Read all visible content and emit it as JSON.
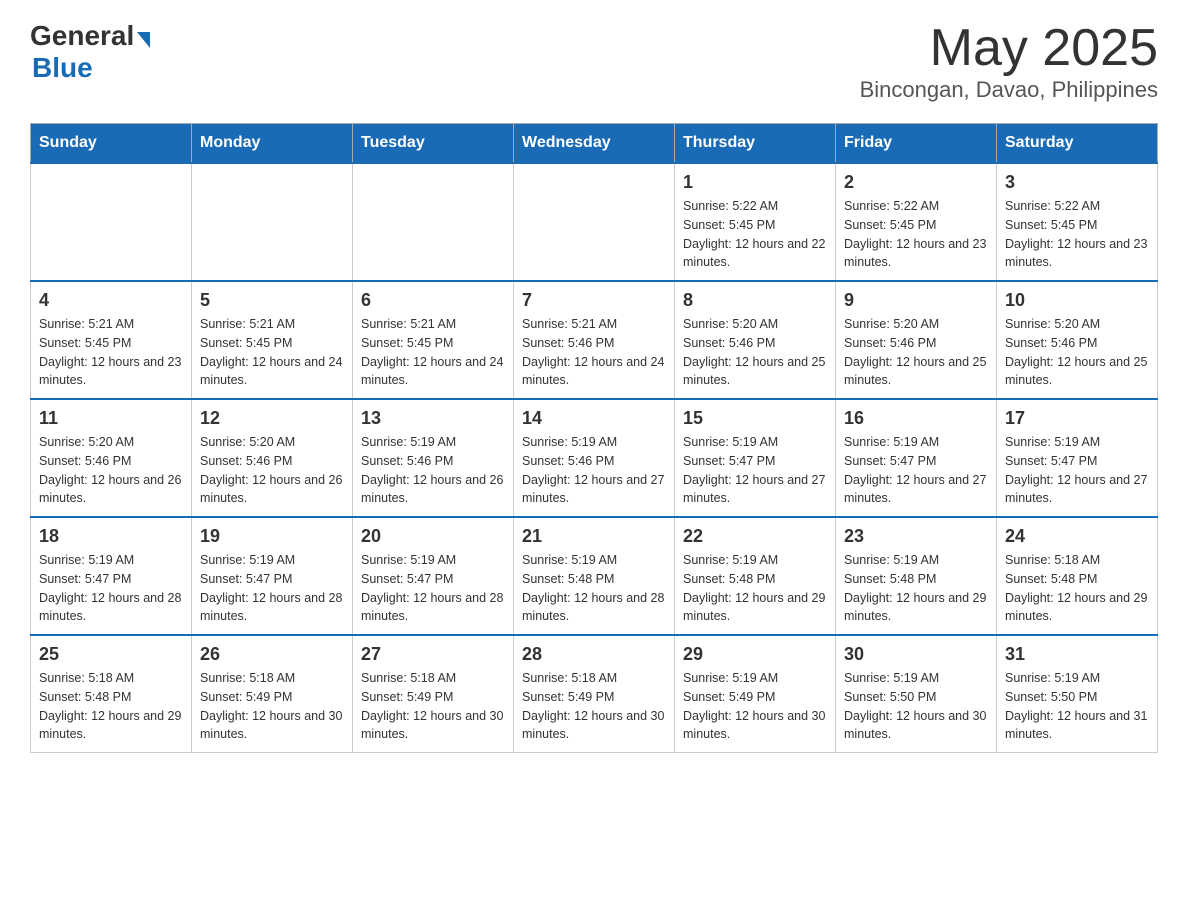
{
  "logo": {
    "text_general": "General",
    "triangle": "▼",
    "text_blue": "Blue"
  },
  "header": {
    "title": "May 2025",
    "subtitle": "Bincongan, Davao, Philippines"
  },
  "days_of_week": [
    "Sunday",
    "Monday",
    "Tuesday",
    "Wednesday",
    "Thursday",
    "Friday",
    "Saturday"
  ],
  "weeks": [
    [
      {
        "day": "",
        "info": ""
      },
      {
        "day": "",
        "info": ""
      },
      {
        "day": "",
        "info": ""
      },
      {
        "day": "",
        "info": ""
      },
      {
        "day": "1",
        "info": "Sunrise: 5:22 AM\nSunset: 5:45 PM\nDaylight: 12 hours and 22 minutes."
      },
      {
        "day": "2",
        "info": "Sunrise: 5:22 AM\nSunset: 5:45 PM\nDaylight: 12 hours and 23 minutes."
      },
      {
        "day": "3",
        "info": "Sunrise: 5:22 AM\nSunset: 5:45 PM\nDaylight: 12 hours and 23 minutes."
      }
    ],
    [
      {
        "day": "4",
        "info": "Sunrise: 5:21 AM\nSunset: 5:45 PM\nDaylight: 12 hours and 23 minutes."
      },
      {
        "day": "5",
        "info": "Sunrise: 5:21 AM\nSunset: 5:45 PM\nDaylight: 12 hours and 24 minutes."
      },
      {
        "day": "6",
        "info": "Sunrise: 5:21 AM\nSunset: 5:45 PM\nDaylight: 12 hours and 24 minutes."
      },
      {
        "day": "7",
        "info": "Sunrise: 5:21 AM\nSunset: 5:46 PM\nDaylight: 12 hours and 24 minutes."
      },
      {
        "day": "8",
        "info": "Sunrise: 5:20 AM\nSunset: 5:46 PM\nDaylight: 12 hours and 25 minutes."
      },
      {
        "day": "9",
        "info": "Sunrise: 5:20 AM\nSunset: 5:46 PM\nDaylight: 12 hours and 25 minutes."
      },
      {
        "day": "10",
        "info": "Sunrise: 5:20 AM\nSunset: 5:46 PM\nDaylight: 12 hours and 25 minutes."
      }
    ],
    [
      {
        "day": "11",
        "info": "Sunrise: 5:20 AM\nSunset: 5:46 PM\nDaylight: 12 hours and 26 minutes."
      },
      {
        "day": "12",
        "info": "Sunrise: 5:20 AM\nSunset: 5:46 PM\nDaylight: 12 hours and 26 minutes."
      },
      {
        "day": "13",
        "info": "Sunrise: 5:19 AM\nSunset: 5:46 PM\nDaylight: 12 hours and 26 minutes."
      },
      {
        "day": "14",
        "info": "Sunrise: 5:19 AM\nSunset: 5:46 PM\nDaylight: 12 hours and 27 minutes."
      },
      {
        "day": "15",
        "info": "Sunrise: 5:19 AM\nSunset: 5:47 PM\nDaylight: 12 hours and 27 minutes."
      },
      {
        "day": "16",
        "info": "Sunrise: 5:19 AM\nSunset: 5:47 PM\nDaylight: 12 hours and 27 minutes."
      },
      {
        "day": "17",
        "info": "Sunrise: 5:19 AM\nSunset: 5:47 PM\nDaylight: 12 hours and 27 minutes."
      }
    ],
    [
      {
        "day": "18",
        "info": "Sunrise: 5:19 AM\nSunset: 5:47 PM\nDaylight: 12 hours and 28 minutes."
      },
      {
        "day": "19",
        "info": "Sunrise: 5:19 AM\nSunset: 5:47 PM\nDaylight: 12 hours and 28 minutes."
      },
      {
        "day": "20",
        "info": "Sunrise: 5:19 AM\nSunset: 5:47 PM\nDaylight: 12 hours and 28 minutes."
      },
      {
        "day": "21",
        "info": "Sunrise: 5:19 AM\nSunset: 5:48 PM\nDaylight: 12 hours and 28 minutes."
      },
      {
        "day": "22",
        "info": "Sunrise: 5:19 AM\nSunset: 5:48 PM\nDaylight: 12 hours and 29 minutes."
      },
      {
        "day": "23",
        "info": "Sunrise: 5:19 AM\nSunset: 5:48 PM\nDaylight: 12 hours and 29 minutes."
      },
      {
        "day": "24",
        "info": "Sunrise: 5:18 AM\nSunset: 5:48 PM\nDaylight: 12 hours and 29 minutes."
      }
    ],
    [
      {
        "day": "25",
        "info": "Sunrise: 5:18 AM\nSunset: 5:48 PM\nDaylight: 12 hours and 29 minutes."
      },
      {
        "day": "26",
        "info": "Sunrise: 5:18 AM\nSunset: 5:49 PM\nDaylight: 12 hours and 30 minutes."
      },
      {
        "day": "27",
        "info": "Sunrise: 5:18 AM\nSunset: 5:49 PM\nDaylight: 12 hours and 30 minutes."
      },
      {
        "day": "28",
        "info": "Sunrise: 5:18 AM\nSunset: 5:49 PM\nDaylight: 12 hours and 30 minutes."
      },
      {
        "day": "29",
        "info": "Sunrise: 5:19 AM\nSunset: 5:49 PM\nDaylight: 12 hours and 30 minutes."
      },
      {
        "day": "30",
        "info": "Sunrise: 5:19 AM\nSunset: 5:50 PM\nDaylight: 12 hours and 30 minutes."
      },
      {
        "day": "31",
        "info": "Sunrise: 5:19 AM\nSunset: 5:50 PM\nDaylight: 12 hours and 31 minutes."
      }
    ]
  ],
  "colors": {
    "header_bg": "#1a6bb5",
    "header_text": "#ffffff",
    "border": "#aaaaaa",
    "row_border_top": "#1a6bb5"
  }
}
